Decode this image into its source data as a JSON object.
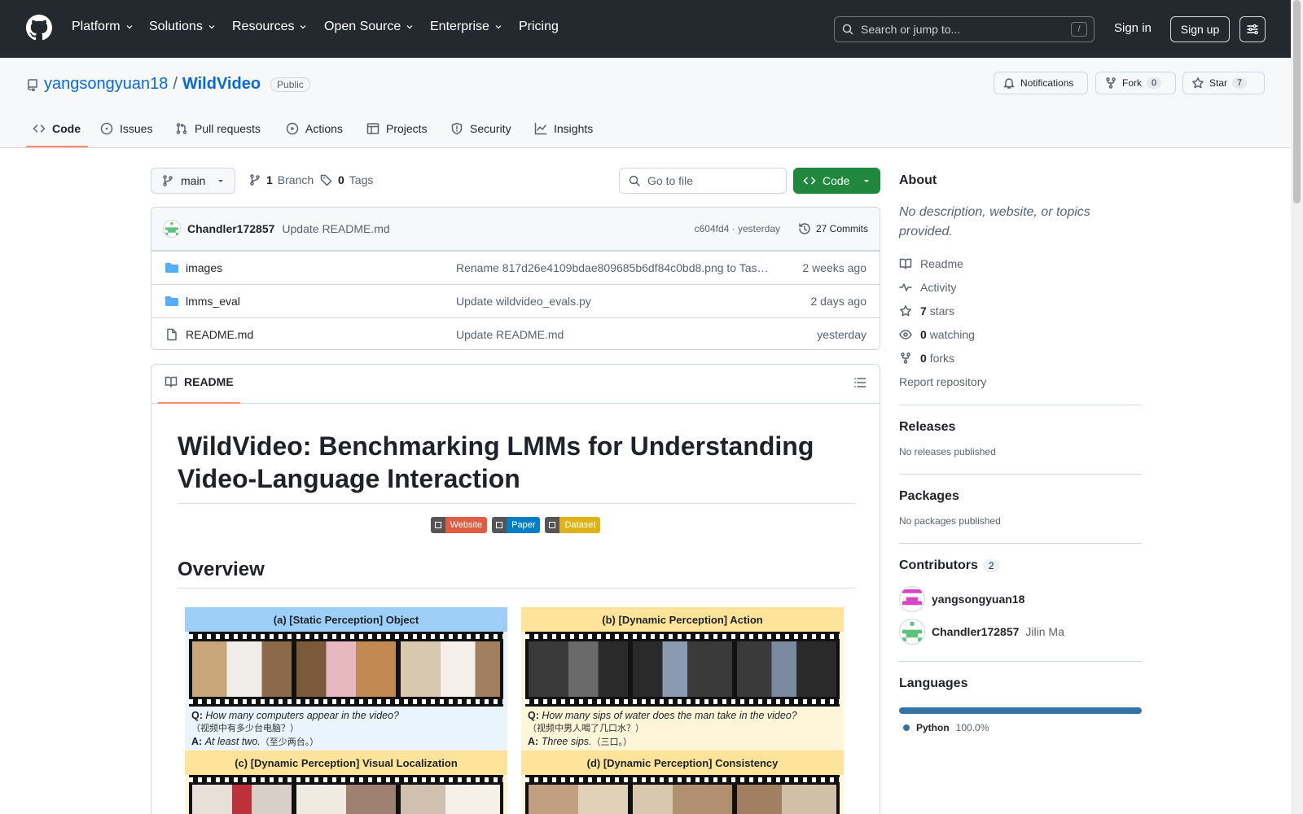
{
  "header": {
    "nav": [
      {
        "label": "Platform",
        "dropdown": true
      },
      {
        "label": "Solutions",
        "dropdown": true
      },
      {
        "label": "Resources",
        "dropdown": true
      },
      {
        "label": "Open Source",
        "dropdown": true
      },
      {
        "label": "Enterprise",
        "dropdown": true
      },
      {
        "label": "Pricing",
        "dropdown": false
      }
    ],
    "search_placeholder": "Search or jump to...",
    "search_shortcut": "/",
    "sign_in": "Sign in",
    "sign_up": "Sign up"
  },
  "repo": {
    "owner": "yangsongyuan18",
    "separator": "/",
    "name": "WildVideo",
    "visibility": "Public",
    "notifications_label": "Notifications",
    "fork_label": "Fork",
    "fork_count": "0",
    "star_label": "Star",
    "star_count": "7"
  },
  "tabs": [
    {
      "label": "Code",
      "icon": "code-icon",
      "selected": true
    },
    {
      "label": "Issues",
      "icon": "issue-icon"
    },
    {
      "label": "Pull requests",
      "icon": "pull-request-icon"
    },
    {
      "label": "Actions",
      "icon": "play-icon"
    },
    {
      "label": "Projects",
      "icon": "table-icon"
    },
    {
      "label": "Security",
      "icon": "shield-icon"
    },
    {
      "label": "Insights",
      "icon": "graph-icon"
    }
  ],
  "branch_bar": {
    "branch": "main",
    "branch_count": "1",
    "branch_label": "Branch",
    "tag_count": "0",
    "tag_label": "Tags",
    "goto_placeholder": "Go to file",
    "code_button": "Code"
  },
  "latest_commit": {
    "author": "Chandler172857",
    "message": "Update README.md",
    "hash": "c604fd4",
    "time": "yesterday",
    "commit_count_label": "27 Commits"
  },
  "files": [
    {
      "type": "folder",
      "name": "images",
      "message": "Rename 817d26e4109bdae809685b6df84c0bd8.png to Tas…",
      "date": "2 weeks ago"
    },
    {
      "type": "folder",
      "name": "lmms_eval",
      "message": "Update wildvideo_evals.py",
      "date": "2 days ago"
    },
    {
      "type": "file",
      "name": "README.md",
      "message": "Update README.md",
      "date": "yesterday"
    }
  ],
  "readme": {
    "tab_label": "README",
    "title": "WildVideo: Benchmarking LMMs for Understanding Video-Language Interaction",
    "badges": [
      {
        "label": "Website",
        "color": "#e05d44"
      },
      {
        "label": "Paper",
        "color": "#007ec6"
      },
      {
        "label": "Dataset",
        "color": "#dfb317"
      }
    ],
    "overview_heading": "Overview",
    "panels": [
      {
        "title": "(a) [Static Perception] Object",
        "title_bg": "#9ecff6",
        "body_bg": "#eaf4fd",
        "q_prefix": "Q:",
        "q": "How many computers appear in the video?",
        "q_cn": "（视频中有多少台电脑？）",
        "a_prefix": "A:",
        "a": "At least two.",
        "a_cn": "（至少两台。）"
      },
      {
        "title": "(b) [Dynamic Perception] Action",
        "title_bg": "#fde49a",
        "body_bg": "#fff5d9",
        "q_prefix": "Q:",
        "q": "How many sips of water does the man take in the video?",
        "q_cn": "（视频中男人喝了几口水？）",
        "a_prefix": "A:",
        "a": "Three sips.",
        "a_cn": "（三口。）"
      },
      {
        "title": "(c) [Dynamic Perception] Visual Localization",
        "title_bg": "#fde49a",
        "body_bg": "#fff5d9"
      },
      {
        "title": "(d) [Dynamic Perception] Consistency",
        "title_bg": "#fde49a",
        "body_bg": "#fff5d9"
      }
    ]
  },
  "sidebar": {
    "about_heading": "About",
    "about_description": "No description, website, or topics provided.",
    "links": [
      {
        "icon": "book-icon",
        "count": "",
        "label": "Readme"
      },
      {
        "icon": "pulse-icon",
        "count": "",
        "label": "Activity"
      },
      {
        "icon": "star-icon",
        "count": "7",
        "label": "stars"
      },
      {
        "icon": "eye-icon",
        "count": "0",
        "label": "watching"
      },
      {
        "icon": "fork-icon",
        "count": "0",
        "label": "forks"
      }
    ],
    "report": "Report repository",
    "releases_heading": "Releases",
    "releases_empty": "No releases published",
    "packages_heading": "Packages",
    "packages_empty": "No packages published",
    "contributors_heading": "Contributors",
    "contributors_count": "2",
    "contributors": [
      {
        "login": "yangsongyuan18",
        "name": "",
        "avatar_color": "#d946c8"
      },
      {
        "login": "Chandler172857",
        "name": "Jilin Ma",
        "avatar_color": "#5cc47a"
      }
    ],
    "languages_heading": "Languages",
    "languages": [
      {
        "name": "Python",
        "percent": "100.0%",
        "color": "#3572A5",
        "share": 1.0
      }
    ]
  }
}
